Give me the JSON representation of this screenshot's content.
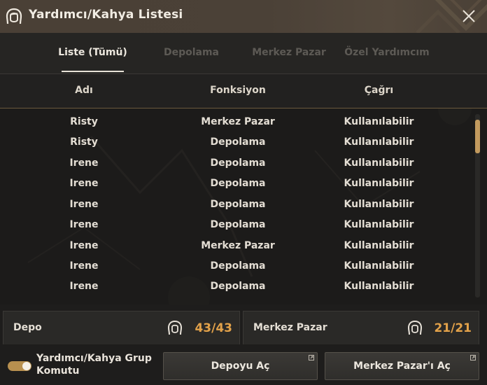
{
  "window": {
    "title": "Yardımcı/Kahya Listesi",
    "title_icon": "servant-head-icon",
    "close_icon": "close-icon"
  },
  "tabs": [
    {
      "label": "Liste (Tümü)",
      "active": true
    },
    {
      "label": "Depolama",
      "active": false
    },
    {
      "label": "Merkez Pazar",
      "active": false
    },
    {
      "label": "Özel Yardımcım",
      "active": false
    }
  ],
  "table": {
    "columns": [
      "Adı",
      "Fonksiyon",
      "Çağrı"
    ],
    "rows": [
      {
        "name": "Risty",
        "function": "Merkez Pazar",
        "call": "Kullanılabilir"
      },
      {
        "name": "Risty",
        "function": "Depolama",
        "call": "Kullanılabilir"
      },
      {
        "name": "Irene",
        "function": "Depolama",
        "call": "Kullanılabilir"
      },
      {
        "name": "Irene",
        "function": "Depolama",
        "call": "Kullanılabilir"
      },
      {
        "name": "Irene",
        "function": "Depolama",
        "call": "Kullanılabilir"
      },
      {
        "name": "Irene",
        "function": "Depolama",
        "call": "Kullanılabilir"
      },
      {
        "name": "Irene",
        "function": "Merkez Pazar",
        "call": "Kullanılabilir"
      },
      {
        "name": "Irene",
        "function": "Depolama",
        "call": "Kullanılabilir"
      },
      {
        "name": "Irene",
        "function": "Depolama",
        "call": "Kullanılabilir"
      }
    ]
  },
  "panels": {
    "depot": {
      "label": "Depo",
      "count": "43/43",
      "icon": "servant-head-icon"
    },
    "market": {
      "label": "Merkez Pazar",
      "count": "21/21",
      "icon": "servant-head-icon"
    }
  },
  "footer": {
    "toggle_label": "Yardımcı/Kahya Grup Komutu",
    "toggle_on": true,
    "open_depot_label": "Depoyu Aç",
    "open_market_label": "Merkez Pazar'ı Aç"
  },
  "colors": {
    "accent": "#e3a24a",
    "toggle": "#b8904f",
    "scroll_thumb": "#c29a5e"
  }
}
